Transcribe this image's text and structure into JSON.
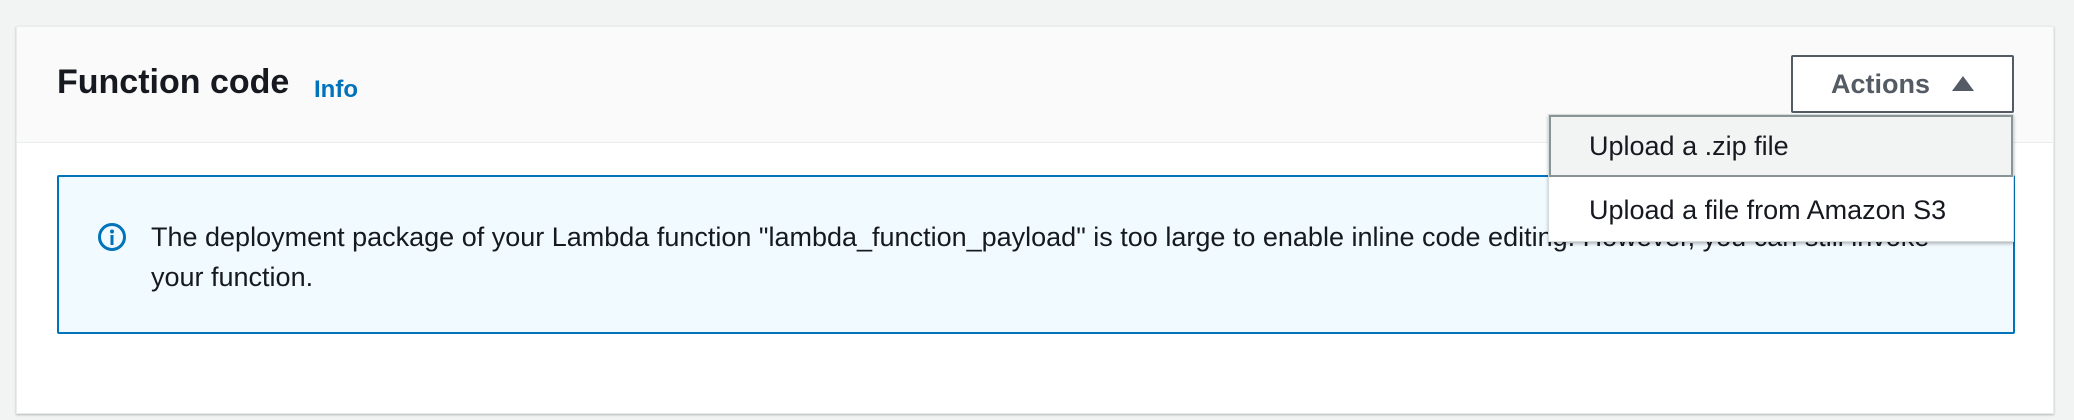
{
  "header": {
    "title": "Function code",
    "info_label": "Info",
    "actions_label": "Actions"
  },
  "actions_menu": {
    "items": [
      {
        "label": "Upload a .zip file"
      },
      {
        "label": "Upload a file from Amazon S3"
      }
    ]
  },
  "alert": {
    "message": "The deployment package of your Lambda function \"lambda_function_payload\" is too large to enable inline code editing. However, you can still invoke your function.",
    "icon": "info-icon"
  },
  "colors": {
    "link": "#0073bb",
    "alert_border": "#0073bb",
    "alert_background": "#f1faff",
    "button_text": "#545b64"
  }
}
